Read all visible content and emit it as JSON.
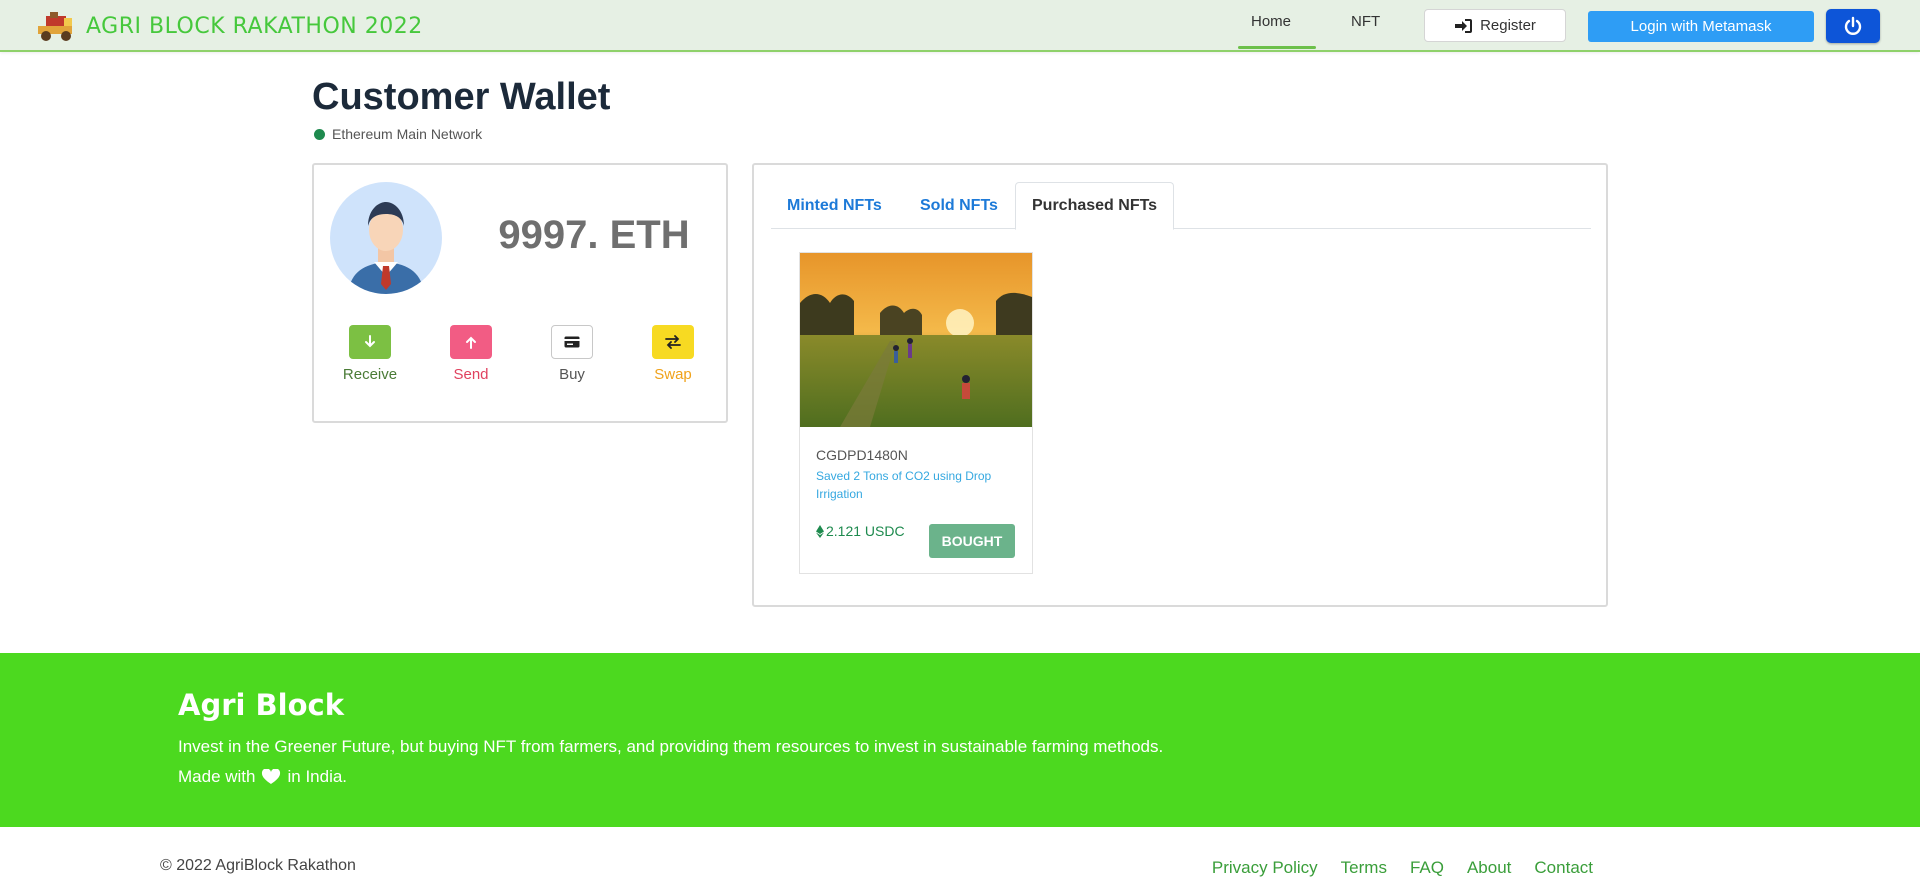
{
  "navbar": {
    "brand": "AGRI BLOCK RAKATHON 2022",
    "links": {
      "home": "Home",
      "nft": "NFT"
    },
    "register_label": "Register",
    "metamask_label": "Login with Metamask",
    "colors": {
      "brand": "#46c83c",
      "metamask": "#2e9df5",
      "power": "#0d55d8"
    }
  },
  "page": {
    "title": "Customer Wallet",
    "network": "Ethereum Main Network"
  },
  "wallet": {
    "balance": "9997. ETH",
    "actions": {
      "receive": "Receive",
      "send": "Send",
      "buy": "Buy",
      "swap": "Swap"
    }
  },
  "nfts": {
    "tabs": {
      "minted": "Minted NFTs",
      "sold": "Sold NFTs",
      "purchased": "Purchased NFTs"
    },
    "active_tab": "Purchased NFTs",
    "items": [
      {
        "code": "CGDPD1480N",
        "description": "Saved 2 Tons of CO2 using Drop Irrigation",
        "price": "2.121 USDC",
        "status": "BOUGHT"
      }
    ]
  },
  "footer": {
    "title": "Agri Block",
    "description": "Invest in the Greener Future, but buying NFT from farmers, and providing them resources to invest in sustainable farming methods.",
    "made_prefix": "Made with",
    "made_suffix": "in India.",
    "copyright": "© 2022 AgriBlock Rakathon",
    "links": {
      "privacy": "Privacy Policy",
      "terms": "Terms",
      "faq": "FAQ",
      "about": "About",
      "contact": "Contact"
    },
    "color": "#4cd91f"
  }
}
